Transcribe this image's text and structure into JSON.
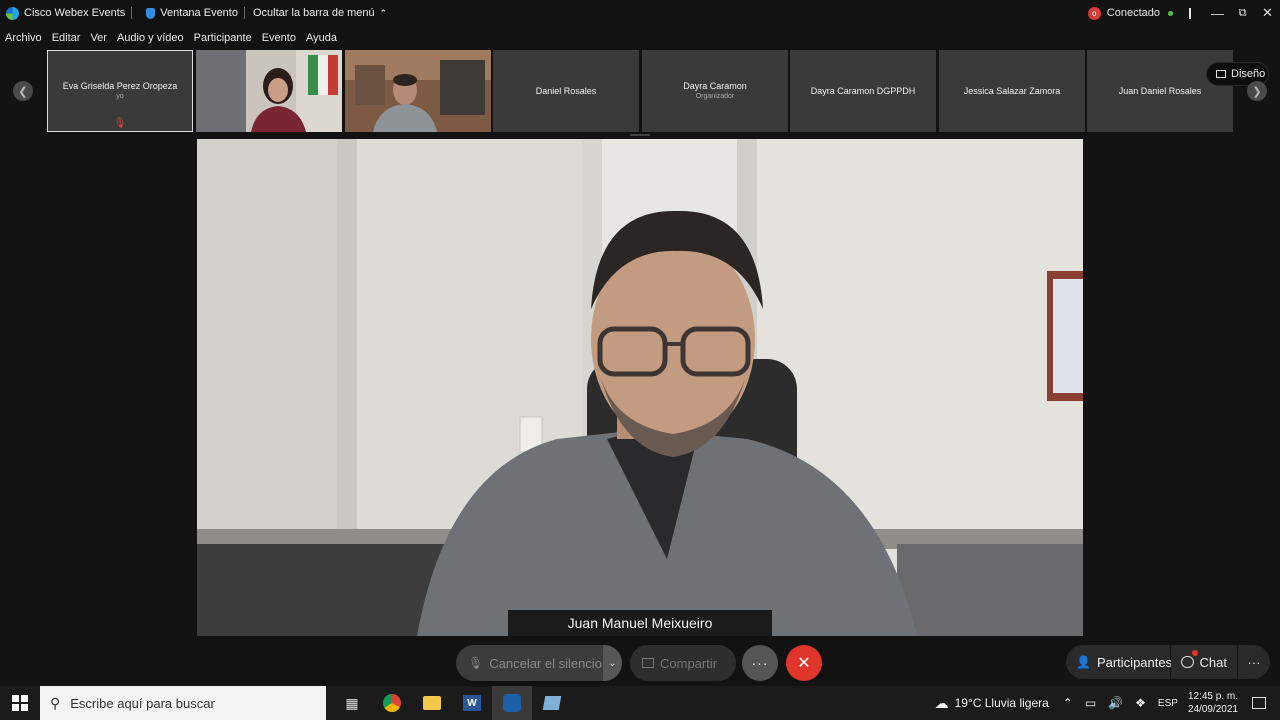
{
  "titlebar": {
    "app_name": "Cisco Webex Events",
    "event_window": "Ventana Evento",
    "hide_menu": "Ocultar la barra de menú",
    "status": "Conectado",
    "status_initial": "o"
  },
  "menu": [
    "Archivo",
    "Editar",
    "Ver",
    "Audio y vídeo",
    "Participante",
    "Evento",
    "Ayuda"
  ],
  "participants_strip": {
    "self": {
      "name": "Eva Griselda Perez Oropeza",
      "sub": "yo"
    },
    "tiles": [
      {
        "name": "Daniel Rosales",
        "sub": ""
      },
      {
        "name": "Dayra Caramon",
        "sub": "Organizador"
      },
      {
        "name": "Dayra Caramon  DGPPDH",
        "sub": ""
      },
      {
        "name": "Jessica Salazar Zamora",
        "sub": ""
      },
      {
        "name": "Juan Daniel Rosales",
        "sub": ""
      }
    ],
    "layout_label": "Diseño"
  },
  "active_speaker": "Juan Manuel Meixueiro",
  "controls": {
    "unmute": "Cancelar el silencio",
    "share": "Compartir",
    "more": "···",
    "participants": "Participantes",
    "chat": "Chat"
  },
  "taskbar": {
    "search_placeholder": "Escribe aquí para buscar",
    "weather": "19°C  Lluvia ligera",
    "lang": "ESP",
    "time": "12:45 p. m.",
    "date": "24/09/2021"
  },
  "colors": {
    "leave": "#e0352b",
    "status": "#4fbf4f"
  }
}
